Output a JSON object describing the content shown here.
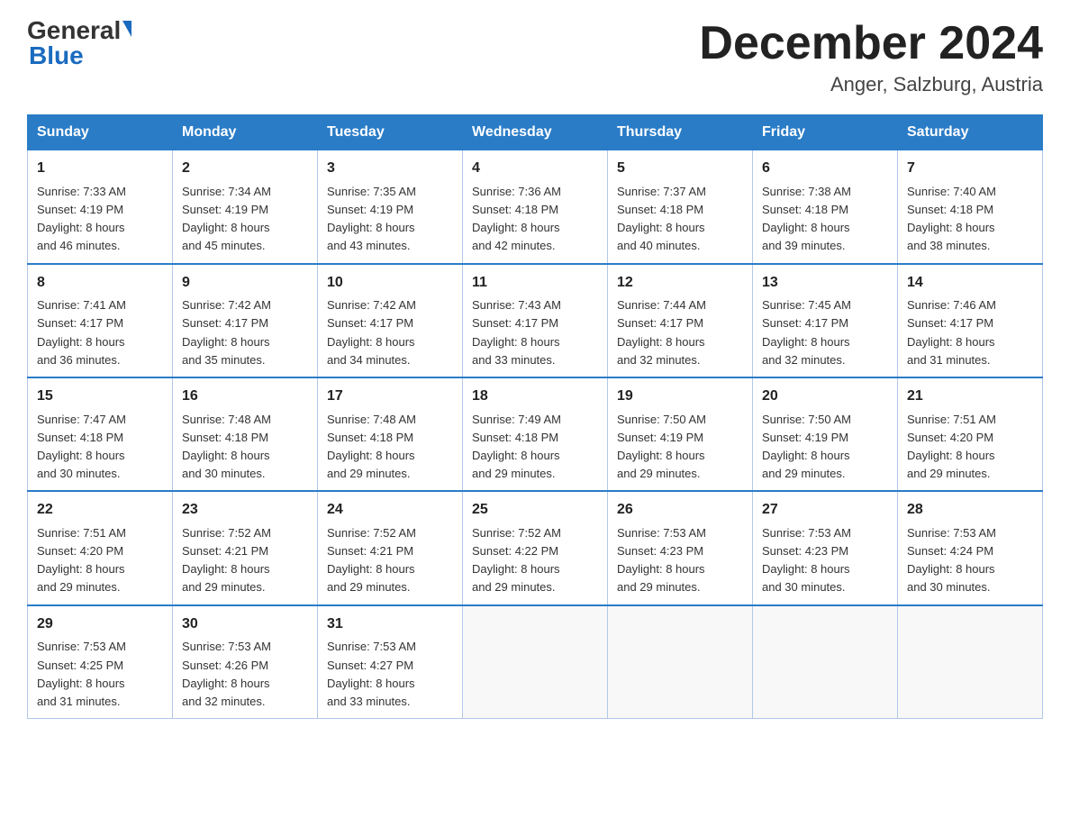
{
  "header": {
    "logo_general": "General",
    "logo_blue": "Blue",
    "main_title": "December 2024",
    "subtitle": "Anger, Salzburg, Austria"
  },
  "days_of_week": [
    "Sunday",
    "Monday",
    "Tuesday",
    "Wednesday",
    "Thursday",
    "Friday",
    "Saturday"
  ],
  "weeks": [
    [
      {
        "day": "1",
        "sunrise": "7:33 AM",
        "sunset": "4:19 PM",
        "daylight": "8 hours and 46 minutes."
      },
      {
        "day": "2",
        "sunrise": "7:34 AM",
        "sunset": "4:19 PM",
        "daylight": "8 hours and 45 minutes."
      },
      {
        "day": "3",
        "sunrise": "7:35 AM",
        "sunset": "4:19 PM",
        "daylight": "8 hours and 43 minutes."
      },
      {
        "day": "4",
        "sunrise": "7:36 AM",
        "sunset": "4:18 PM",
        "daylight": "8 hours and 42 minutes."
      },
      {
        "day": "5",
        "sunrise": "7:37 AM",
        "sunset": "4:18 PM",
        "daylight": "8 hours and 40 minutes."
      },
      {
        "day": "6",
        "sunrise": "7:38 AM",
        "sunset": "4:18 PM",
        "daylight": "8 hours and 39 minutes."
      },
      {
        "day": "7",
        "sunrise": "7:40 AM",
        "sunset": "4:18 PM",
        "daylight": "8 hours and 38 minutes."
      }
    ],
    [
      {
        "day": "8",
        "sunrise": "7:41 AM",
        "sunset": "4:17 PM",
        "daylight": "8 hours and 36 minutes."
      },
      {
        "day": "9",
        "sunrise": "7:42 AM",
        "sunset": "4:17 PM",
        "daylight": "8 hours and 35 minutes."
      },
      {
        "day": "10",
        "sunrise": "7:42 AM",
        "sunset": "4:17 PM",
        "daylight": "8 hours and 34 minutes."
      },
      {
        "day": "11",
        "sunrise": "7:43 AM",
        "sunset": "4:17 PM",
        "daylight": "8 hours and 33 minutes."
      },
      {
        "day": "12",
        "sunrise": "7:44 AM",
        "sunset": "4:17 PM",
        "daylight": "8 hours and 32 minutes."
      },
      {
        "day": "13",
        "sunrise": "7:45 AM",
        "sunset": "4:17 PM",
        "daylight": "8 hours and 32 minutes."
      },
      {
        "day": "14",
        "sunrise": "7:46 AM",
        "sunset": "4:17 PM",
        "daylight": "8 hours and 31 minutes."
      }
    ],
    [
      {
        "day": "15",
        "sunrise": "7:47 AM",
        "sunset": "4:18 PM",
        "daylight": "8 hours and 30 minutes."
      },
      {
        "day": "16",
        "sunrise": "7:48 AM",
        "sunset": "4:18 PM",
        "daylight": "8 hours and 30 minutes."
      },
      {
        "day": "17",
        "sunrise": "7:48 AM",
        "sunset": "4:18 PM",
        "daylight": "8 hours and 29 minutes."
      },
      {
        "day": "18",
        "sunrise": "7:49 AM",
        "sunset": "4:18 PM",
        "daylight": "8 hours and 29 minutes."
      },
      {
        "day": "19",
        "sunrise": "7:50 AM",
        "sunset": "4:19 PM",
        "daylight": "8 hours and 29 minutes."
      },
      {
        "day": "20",
        "sunrise": "7:50 AM",
        "sunset": "4:19 PM",
        "daylight": "8 hours and 29 minutes."
      },
      {
        "day": "21",
        "sunrise": "7:51 AM",
        "sunset": "4:20 PM",
        "daylight": "8 hours and 29 minutes."
      }
    ],
    [
      {
        "day": "22",
        "sunrise": "7:51 AM",
        "sunset": "4:20 PM",
        "daylight": "8 hours and 29 minutes."
      },
      {
        "day": "23",
        "sunrise": "7:52 AM",
        "sunset": "4:21 PM",
        "daylight": "8 hours and 29 minutes."
      },
      {
        "day": "24",
        "sunrise": "7:52 AM",
        "sunset": "4:21 PM",
        "daylight": "8 hours and 29 minutes."
      },
      {
        "day": "25",
        "sunrise": "7:52 AM",
        "sunset": "4:22 PM",
        "daylight": "8 hours and 29 minutes."
      },
      {
        "day": "26",
        "sunrise": "7:53 AM",
        "sunset": "4:23 PM",
        "daylight": "8 hours and 29 minutes."
      },
      {
        "day": "27",
        "sunrise": "7:53 AM",
        "sunset": "4:23 PM",
        "daylight": "8 hours and 30 minutes."
      },
      {
        "day": "28",
        "sunrise": "7:53 AM",
        "sunset": "4:24 PM",
        "daylight": "8 hours and 30 minutes."
      }
    ],
    [
      {
        "day": "29",
        "sunrise": "7:53 AM",
        "sunset": "4:25 PM",
        "daylight": "8 hours and 31 minutes."
      },
      {
        "day": "30",
        "sunrise": "7:53 AM",
        "sunset": "4:26 PM",
        "daylight": "8 hours and 32 minutes."
      },
      {
        "day": "31",
        "sunrise": "7:53 AM",
        "sunset": "4:27 PM",
        "daylight": "8 hours and 33 minutes."
      },
      null,
      null,
      null,
      null
    ]
  ],
  "labels": {
    "sunrise": "Sunrise:",
    "sunset": "Sunset:",
    "daylight": "Daylight:"
  }
}
